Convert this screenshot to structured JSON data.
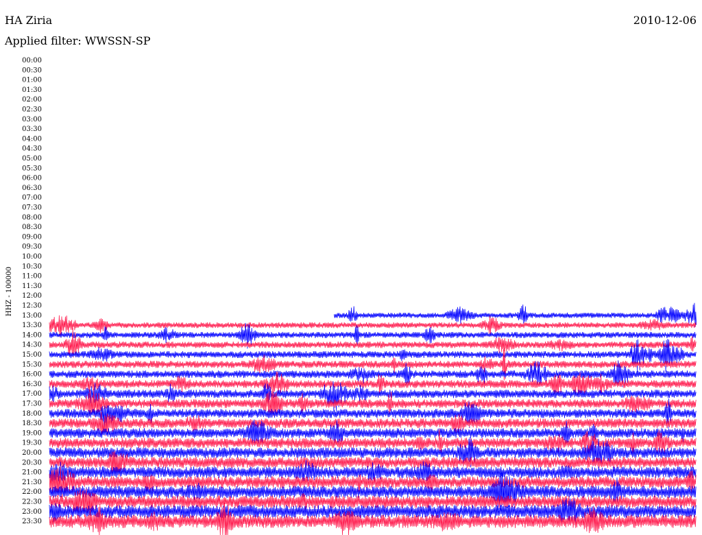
{
  "header": {
    "station": "HA Ziria",
    "date": "2010-12-06",
    "filter_label": "Applied filter: WWSSN-SP"
  },
  "chart_data": {
    "type": "line",
    "title": "HA Ziria",
    "subtitle": "Applied filter: WWSSN-SP",
    "date": "2010-12-06",
    "ylabel": "HHZ - 100000",
    "xlabel": "",
    "row_interval_minutes": 30,
    "y_ticks": [
      "00:00",
      "00:30",
      "01:00",
      "01:30",
      "02:00",
      "02:30",
      "03:00",
      "03:30",
      "04:00",
      "04:30",
      "05:00",
      "05:30",
      "06:00",
      "06:30",
      "07:00",
      "07:30",
      "08:00",
      "08:30",
      "09:00",
      "09:30",
      "10:00",
      "10:30",
      "11:00",
      "11:30",
      "12:00",
      "12:30",
      "13:00",
      "13:30",
      "14:00",
      "14:30",
      "15:00",
      "15:30",
      "16:00",
      "16:30",
      "17:00",
      "17:30",
      "18:00",
      "18:30",
      "19:00",
      "19:30",
      "20:00",
      "20:30",
      "21:00",
      "21:30",
      "22:00",
      "22:30",
      "23:00",
      "23:30"
    ],
    "data_start": "13:00",
    "data_start_fraction_of_first_row": 0.44,
    "trace_colors": [
      "#0000ff",
      "#ff1a4d"
    ],
    "grid": false
  }
}
